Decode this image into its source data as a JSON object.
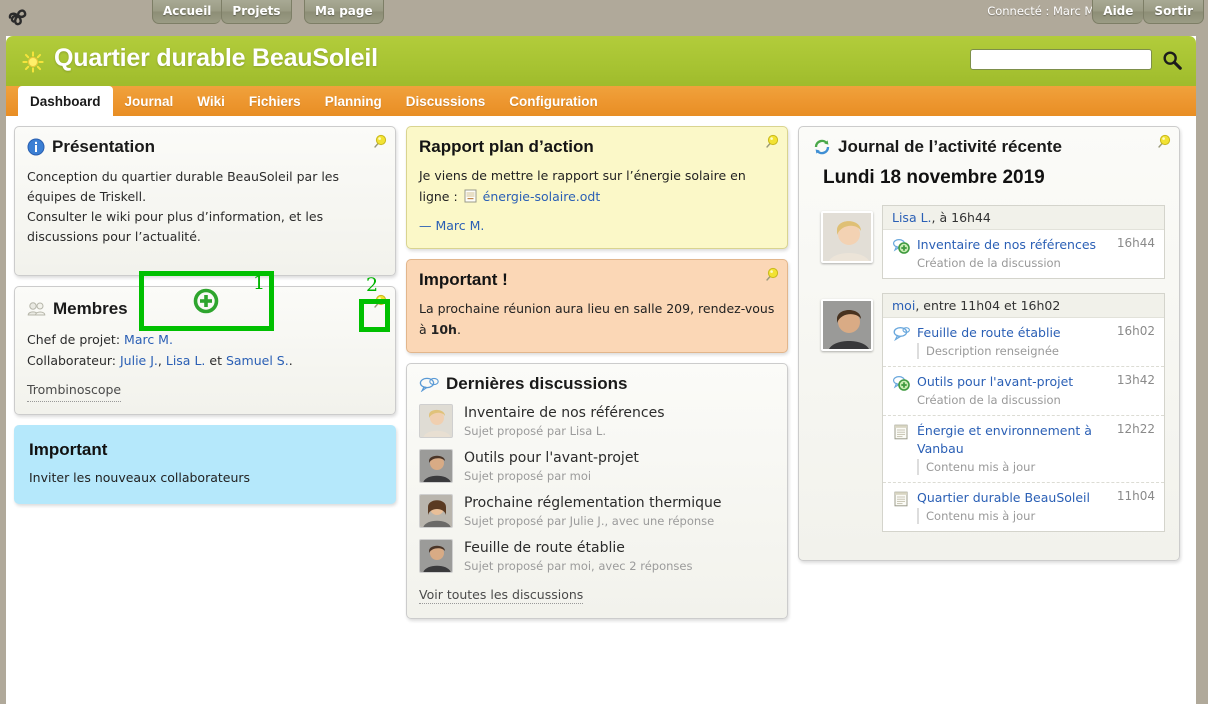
{
  "topbar": {
    "logo_icon": "triskell-logo",
    "nav": [
      {
        "label": "Accueil",
        "name": "accueil"
      },
      {
        "label": "Projets",
        "name": "projets"
      }
    ],
    "mypage": {
      "label": "Ma page",
      "name": "ma-page"
    },
    "connected": "Connecté : Marc M.",
    "help": {
      "label": "Aide",
      "name": "aide"
    },
    "logout": {
      "label": "Sortir",
      "name": "sortir"
    }
  },
  "header": {
    "title": "Quartier durable BeauSoleil",
    "icon": "sun-icon",
    "search": {
      "value": "",
      "placeholder": ""
    },
    "search_icon": "search-icon"
  },
  "tabs": [
    {
      "label": "Dashboard",
      "active": true
    },
    {
      "label": "Journal",
      "active": false
    },
    {
      "label": "Wiki",
      "active": false
    },
    {
      "label": "Fichiers",
      "active": false
    },
    {
      "label": "Planning",
      "active": false
    },
    {
      "label": "Discussions",
      "active": false
    },
    {
      "label": "Configuration",
      "active": false
    }
  ],
  "presentation": {
    "title": "Présentation",
    "icon": "info-icon",
    "pin_icon": "pin-icon",
    "line1": "Conception du quartier durable BeauSoleil par les équipes de Triskell.",
    "line2": "Consulter le wiki pour plus d’information, et les discussions pour l’actualité."
  },
  "membres": {
    "title": "Membres",
    "icon": "users-icon",
    "pin_icon": "pin-icon",
    "chef_label": "Chef de projet:",
    "chef_name": "Marc M.",
    "collab_label": "Collaborateur:",
    "collab_1": "Julie J.",
    "collab_sep1": ",",
    "collab_2": "Lisa L.",
    "collab_and": "et",
    "collab_3": "Samuel S.",
    "collab_end": ".",
    "trombinoscope": "Trombinoscope"
  },
  "important_blue": {
    "title": "Important",
    "body": "Inviter les nouveaux collaborateurs"
  },
  "rapport": {
    "title": "Rapport plan d’action",
    "pin_icon": "pin-icon",
    "text_before": "Je viens de mettre le rapport sur l’énergie solaire en ligne :",
    "file_icon": "document-icon",
    "file_link": "énergie-solaire.odt",
    "signature": "— Marc M."
  },
  "important_peach": {
    "title": "Important !",
    "pin_icon": "pin-icon",
    "text_before": "La prochaine réunion aura lieu en salle 209, rendez-vous à ",
    "bold": "10h",
    "text_after": "."
  },
  "discussions": {
    "title": "Dernières discussions",
    "icon": "speech-bubble-icon",
    "items": [
      {
        "title": "Inventaire de nos références",
        "subtitle": "Sujet proposé par Lisa L.",
        "avatar": "avatar-lisa"
      },
      {
        "title": "Outils pour l'avant-projet",
        "subtitle": "Sujet proposé par moi",
        "avatar": "avatar-marc"
      },
      {
        "title": "Prochaine réglementation thermique",
        "subtitle": "Sujet proposé par Julie J., avec une réponse",
        "avatar": "avatar-julie"
      },
      {
        "title": "Feuille de route établie",
        "subtitle": "Sujet proposé par moi, avec 2 réponses",
        "avatar": "avatar-marc"
      }
    ],
    "see_all": "Voir toutes les discussions"
  },
  "journal": {
    "title": "Journal de l’activité récente",
    "icon": "refresh-icon",
    "pin_icon": "pin-icon",
    "date": "Lundi 18 novembre 2019",
    "groups": [
      {
        "header": "Lisa L., à 16h44",
        "header_user": "Lisa L.",
        "avatar": "avatar-lisa",
        "entries": [
          {
            "icon": "discussion-add-icon",
            "title": "Inventaire de nos références",
            "subtitle": "Création de la discussion",
            "subtitle_line": false,
            "time": "16h44"
          }
        ]
      },
      {
        "header": "moi, entre 11h04 et 16h02",
        "header_user": "moi",
        "avatar": "avatar-marc",
        "entries": [
          {
            "icon": "discussion-icon",
            "title": "Feuille de route établie",
            "subtitle": "Description renseignée",
            "subtitle_line": true,
            "time": "16h02"
          },
          {
            "icon": "discussion-add-icon",
            "title": "Outils pour l'avant-projet",
            "subtitle": "Création de la discussion",
            "subtitle_line": false,
            "time": "13h42"
          },
          {
            "icon": "page-icon",
            "title": "Énergie et environnement à Vanbau",
            "subtitle": "Contenu mis à jour",
            "subtitle_line": true,
            "time": "12h22"
          },
          {
            "icon": "page-icon",
            "title": "Quartier durable BeauSoleil",
            "subtitle": "Contenu mis à jour",
            "subtitle_line": true,
            "time": "11h04"
          }
        ]
      }
    ]
  },
  "annotations": [
    {
      "number": "1",
      "target": "add-block-button"
    },
    {
      "number": "2",
      "target": "pin-icon"
    }
  ],
  "colors": {
    "header_green": "#a7c332",
    "tabbar_orange": "#ed9730",
    "page_bg": "#b0a99a",
    "link_blue": "#2a5fb5",
    "note_yellow": "#fbf8c8",
    "note_peach": "#fbd7b6",
    "note_blue": "#b5e8fb",
    "annotation_green": "#00c000"
  }
}
